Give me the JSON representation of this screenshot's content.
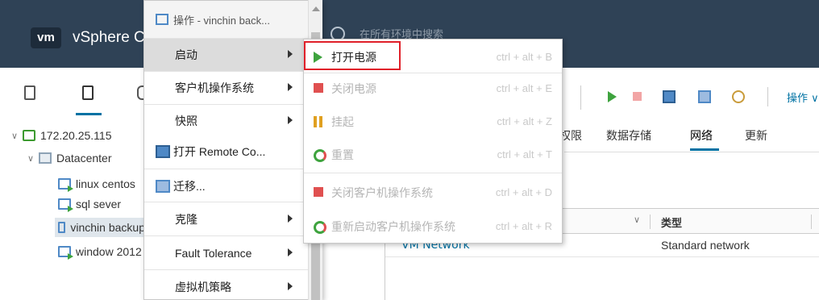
{
  "header": {
    "logo": "vm",
    "app_title": "vSphere Client",
    "search_placeholder": "在所有环境中搜索"
  },
  "tree": {
    "host": "172.20.25.115",
    "datacenter": "Datacenter",
    "vms": [
      "linux centos",
      "sql sever",
      "vinchin backup",
      "window 2012"
    ]
  },
  "main": {
    "actions_label": "操作 ∨",
    "tabs": [
      "权限",
      "数据存储",
      "网络",
      "更新"
    ],
    "active_tab": "网络",
    "table": {
      "type_header": "类型",
      "row_name": "VM Network",
      "row_type": "Standard network"
    }
  },
  "menu1": {
    "header": "操作 - vinchin back...",
    "items": [
      {
        "label": "启动"
      },
      {
        "label": "客户机操作系统"
      },
      {
        "label": "快照"
      },
      {
        "label": "打开 Remote Co..."
      },
      {
        "label": "迁移..."
      },
      {
        "label": "克隆"
      },
      {
        "label": "Fault Tolerance"
      },
      {
        "label": "虚拟机策略"
      }
    ]
  },
  "menu2": {
    "items": [
      {
        "label": "打开电源",
        "shortcut": "ctrl + alt + B"
      },
      {
        "label": "关闭电源",
        "shortcut": "ctrl + alt + E"
      },
      {
        "label": "挂起",
        "shortcut": "ctrl + alt + Z"
      },
      {
        "label": "重置",
        "shortcut": "ctrl + alt + T"
      },
      {
        "label": "关闭客户机操作系统",
        "shortcut": "ctrl + alt + D"
      },
      {
        "label": "重新启动客户机操作系统",
        "shortcut": "ctrl + alt + R"
      }
    ]
  },
  "colors": {
    "header_bg": "#2f4256",
    "accent": "#0072a3",
    "highlight": "#e0202a",
    "power_on": "#3ea33e"
  }
}
